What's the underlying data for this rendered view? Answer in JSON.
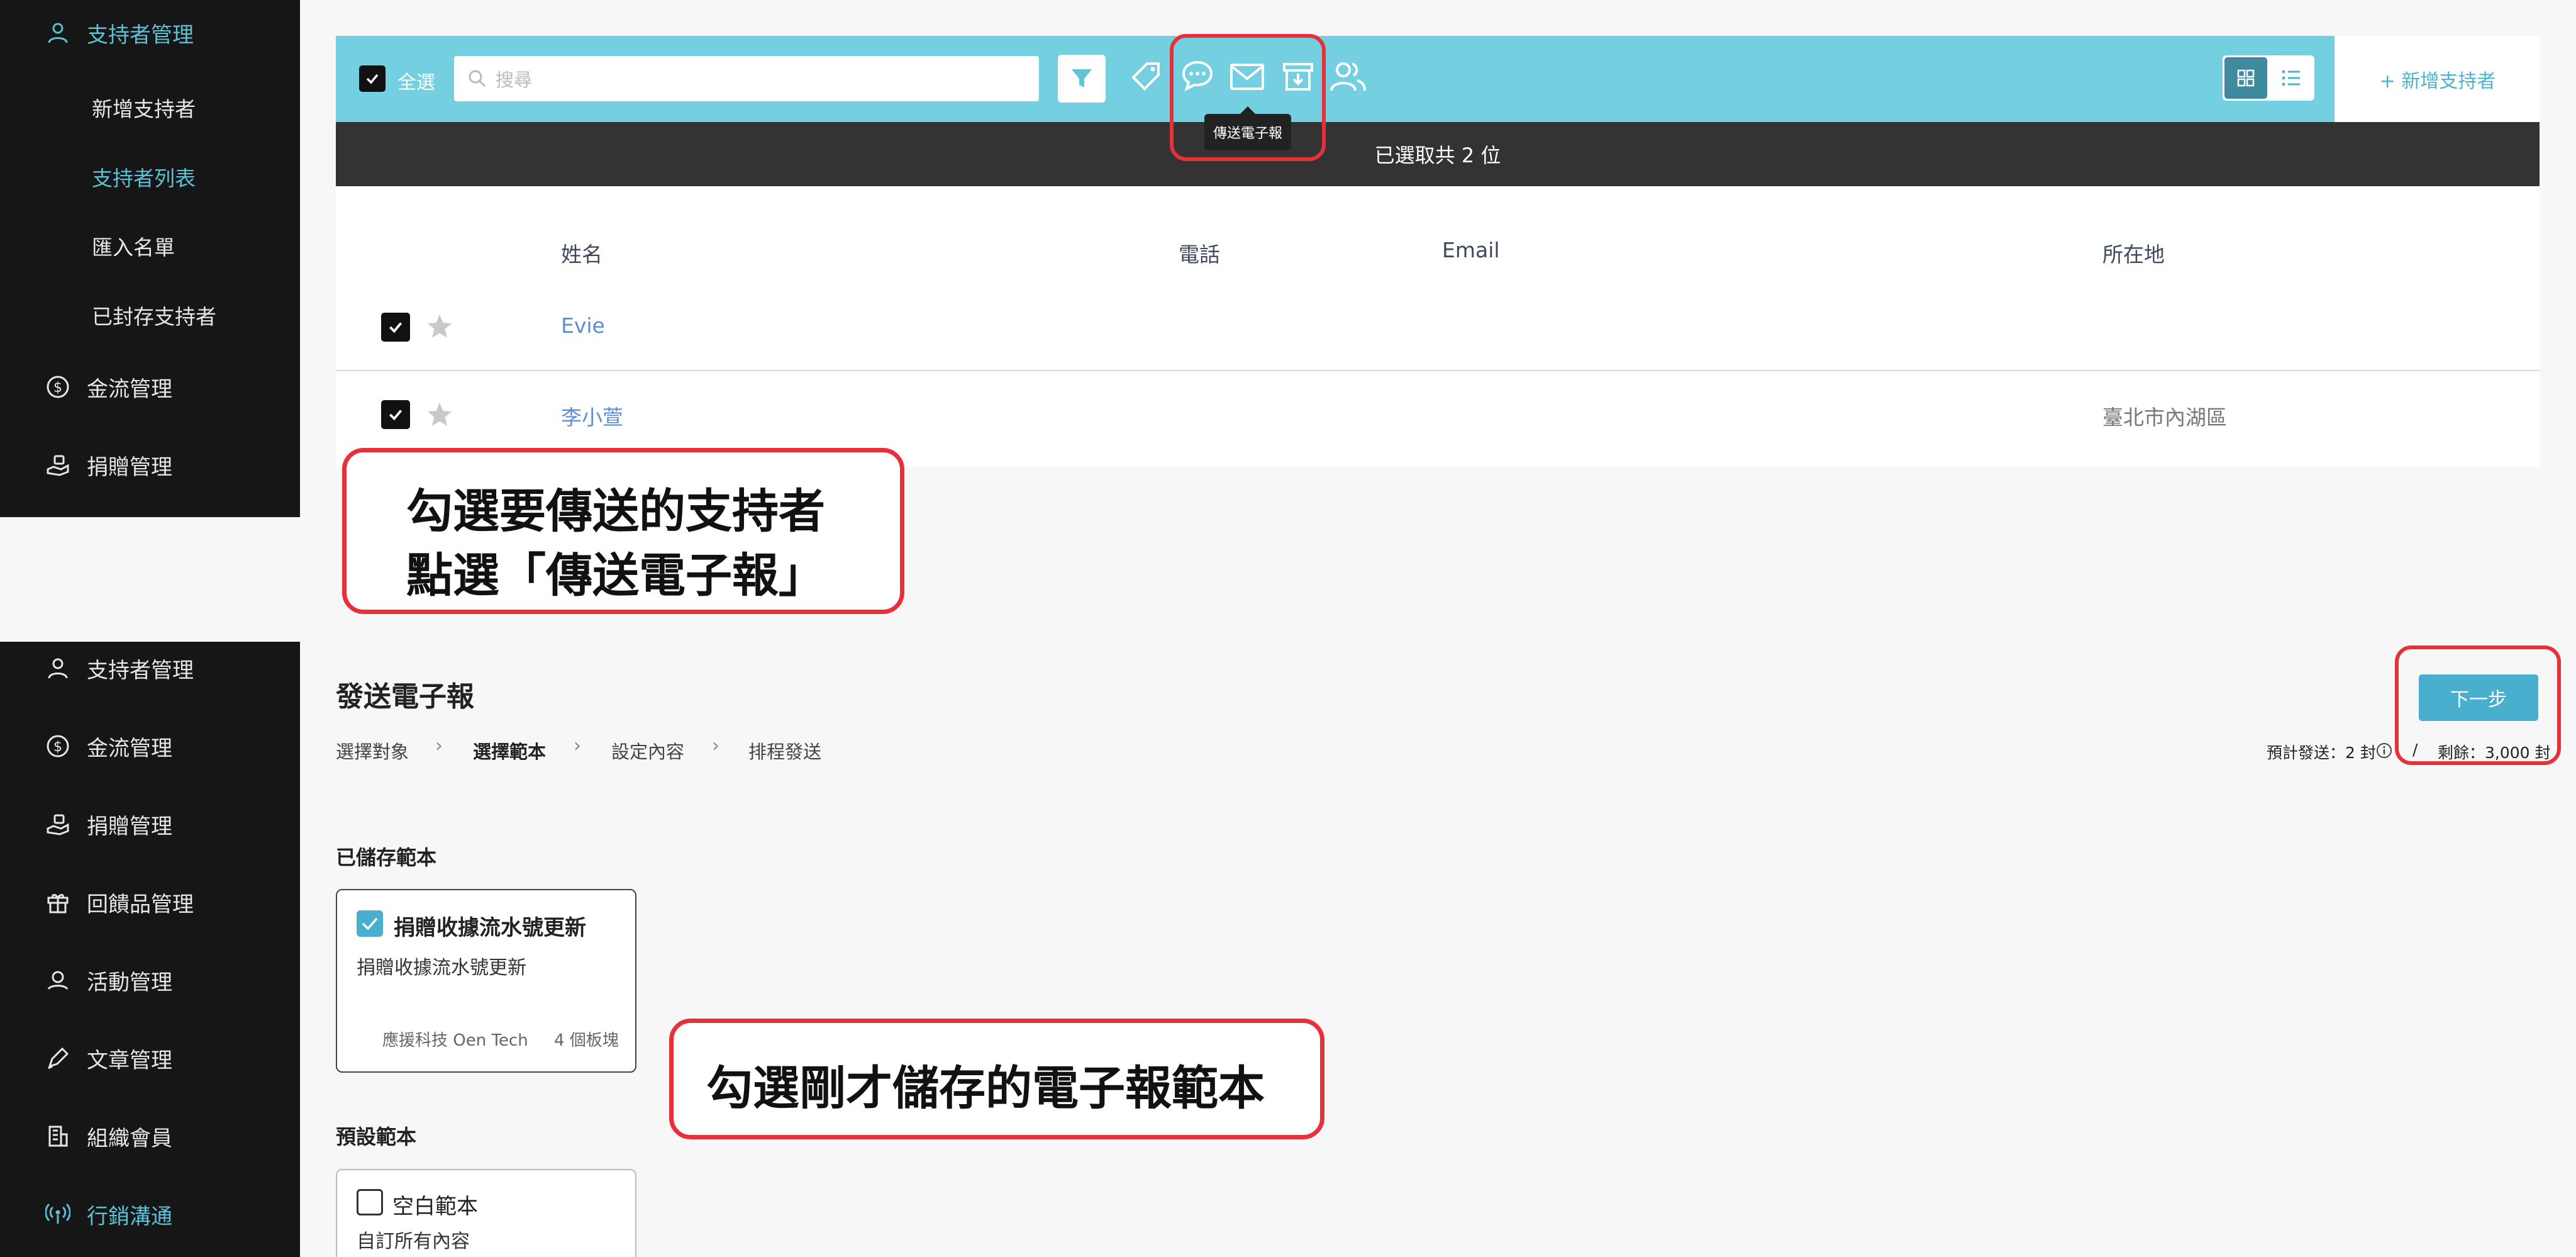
{
  "top_sidebar": {
    "supporter_mgmt": "支持者管理",
    "sub_items": [
      "新增支持者",
      "支持者列表",
      "匯入名單",
      "已封存支持者"
    ],
    "cashflow": "金流管理",
    "donation": "捐贈管理"
  },
  "toolbar": {
    "select_all": "全選",
    "search_placeholder": "搜尋",
    "tooltip": "傳送電子報",
    "add_supporter": "+ 新增支持者",
    "selected_summary": "已選取共 2 位"
  },
  "table": {
    "headers": [
      "姓名",
      "電話",
      "Email",
      "所在地"
    ],
    "rows": [
      {
        "name": "Evie",
        "phone": "",
        "email": "",
        "location": ""
      },
      {
        "name": "李小萱",
        "phone": "",
        "email": "",
        "location": "臺北市內湖區"
      }
    ]
  },
  "annotation1": {
    "line1": "勾選要傳送的支持者",
    "line2": "點選「傳送電子報」"
  },
  "bottom_sidebar": {
    "items": [
      "支持者管理",
      "金流管理",
      "捐贈管理",
      "回饋品管理",
      "活動管理",
      "文章管理",
      "組織會員",
      "行銷溝通"
    ]
  },
  "newsletter": {
    "title": "發送電子報",
    "steps": [
      "選擇對象",
      "選擇範本",
      "設定內容",
      "排程發送"
    ],
    "step_sep": "›",
    "next_button": "下一步",
    "estimate": "預計發送：2 封",
    "slash": "/",
    "remaining": "剩餘：3,000 封",
    "saved_templates_title": "已儲存範本",
    "saved_template": {
      "title": "捐贈收據流水號更新",
      "desc": "捐贈收據流水號更新",
      "org": "應援科技 Oen Tech",
      "blocks": "4 個板塊"
    },
    "default_templates_title": "預設範本",
    "default_template": {
      "title": "空白範本",
      "desc": "自訂所有內容"
    }
  },
  "annotation2": {
    "text": "勾選剛才儲存的電子報範本"
  },
  "colors": {
    "accent": "#4aaecf",
    "toolbar": "#74d0e0",
    "annotation": "#e8303a",
    "sidebar": "#161616"
  }
}
